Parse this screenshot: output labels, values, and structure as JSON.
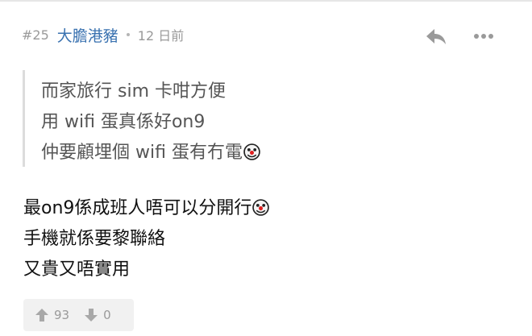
{
  "post": {
    "number": "#25",
    "author": "大膽港豬",
    "time": "12 日前"
  },
  "quote": {
    "lines": [
      "而家旅行 sim 卡咁方便",
      "用 wifi 蛋真係好on9",
      "仲要顧埋個 wifi 蛋有冇電"
    ]
  },
  "content": {
    "lines": [
      "最on9係成班人唔可以分開行",
      "手機就係要黎聯絡",
      "又貴又唔實用"
    ]
  },
  "votes": {
    "up": "93",
    "down": "0"
  },
  "icons": {
    "reply": "reply-arrow-icon",
    "more": "more-dots-icon",
    "emoji": "clown-face-icon",
    "upvote": "arrow-up-icon",
    "downvote": "arrow-down-icon"
  },
  "colors": {
    "author": "#3a72b0",
    "meta": "#9a9a9a",
    "quote_text": "#555555",
    "vote_bg": "#f1f1f1"
  }
}
